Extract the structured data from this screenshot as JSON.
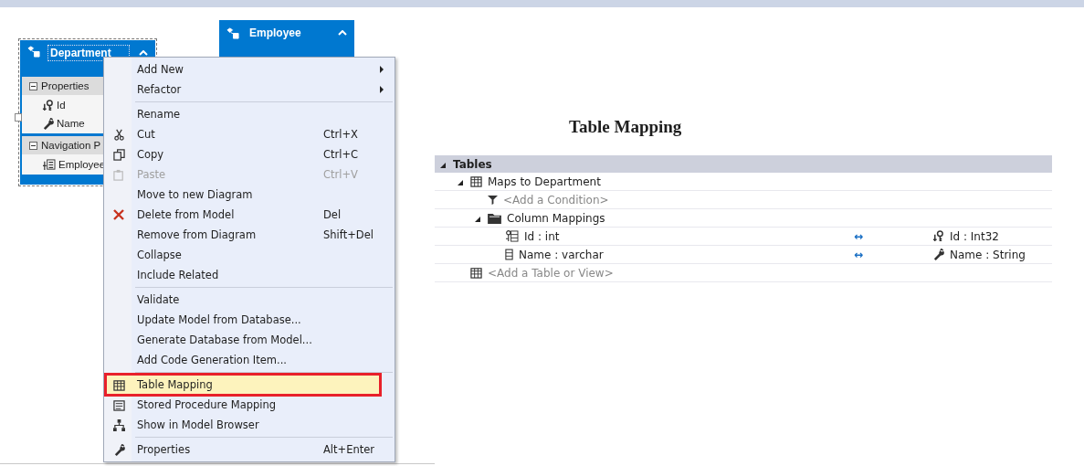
{
  "diagram": {
    "entities": [
      {
        "name": "Department",
        "selected": true,
        "sections": [
          {
            "title": "Properties",
            "expanded": true,
            "items": [
              {
                "kind": "key_property",
                "label": "Id"
              },
              {
                "kind": "property",
                "label": "Name"
              }
            ]
          },
          {
            "title": "Navigation P",
            "expanded": true,
            "items": [
              {
                "kind": "navigation",
                "label": "Employee"
              }
            ]
          }
        ]
      },
      {
        "name": "Employee",
        "selected": false
      }
    ]
  },
  "context_menu": {
    "items": [
      {
        "kind": "item",
        "label": "Add New",
        "submenu": true
      },
      {
        "kind": "item",
        "label": "Refactor",
        "submenu": true
      },
      {
        "kind": "separator"
      },
      {
        "kind": "item",
        "label": "Rename"
      },
      {
        "kind": "item",
        "label": "Cut",
        "shortcut": "Ctrl+X"
      },
      {
        "kind": "item",
        "label": "Copy",
        "shortcut": "Ctrl+C"
      },
      {
        "kind": "item",
        "label": "Paste",
        "shortcut": "Ctrl+V",
        "disabled": true
      },
      {
        "kind": "item",
        "label": "Move to new Diagram"
      },
      {
        "kind": "item",
        "label": "Delete from Model",
        "shortcut": "Del"
      },
      {
        "kind": "item",
        "label": "Remove from Diagram",
        "shortcut": "Shift+Del"
      },
      {
        "kind": "item",
        "label": "Collapse"
      },
      {
        "kind": "item",
        "label": "Include Related"
      },
      {
        "kind": "separator"
      },
      {
        "kind": "item",
        "label": "Validate"
      },
      {
        "kind": "item",
        "label": "Update Model from Database..."
      },
      {
        "kind": "item",
        "label": "Generate Database from Model..."
      },
      {
        "kind": "item",
        "label": "Add Code Generation Item..."
      },
      {
        "kind": "separator"
      },
      {
        "kind": "item",
        "label": "Table Mapping",
        "selected": true,
        "annotated": true
      },
      {
        "kind": "item",
        "label": "Stored Procedure Mapping"
      },
      {
        "kind": "item",
        "label": "Show in Model Browser"
      },
      {
        "kind": "separator"
      },
      {
        "kind": "item",
        "label": "Properties",
        "shortcut": "Alt+Enter"
      }
    ]
  },
  "table_mapping": {
    "title": "Table Mapping",
    "tree": [
      {
        "kind": "header",
        "label": "Tables",
        "expanded": true,
        "children": [
          {
            "kind": "table",
            "label": "Maps to Department",
            "expanded": true,
            "children": [
              {
                "kind": "condition",
                "label": "<Add a Condition>"
              },
              {
                "kind": "folder",
                "label": "Column Mappings",
                "expanded": true,
                "children": [
                  {
                    "kind": "key_mapping",
                    "label": "Id : int",
                    "arrow": "↔",
                    "property": "Id : Int32"
                  },
                  {
                    "kind": "mapping",
                    "label": "Name : varchar",
                    "arrow": "↔",
                    "property": "Name : String"
                  }
                ]
              }
            ]
          },
          {
            "kind": "add_table",
            "label": "<Add a Table or View>"
          }
        ]
      }
    ]
  }
}
